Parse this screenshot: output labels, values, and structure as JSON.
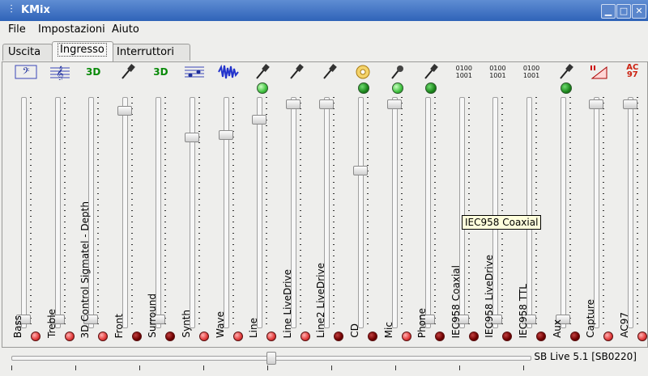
{
  "window": {
    "title": "KMix",
    "minimize": "▁",
    "maximize": "□",
    "close": "✕"
  },
  "menu": [
    "File",
    "Impostazioni",
    "Aiuto"
  ],
  "tabs": [
    {
      "label": "Uscita"
    },
    {
      "label": "Ingresso",
      "active": true
    },
    {
      "label": "Interruttori"
    }
  ],
  "channels": [
    {
      "label": "Bass",
      "icon": "bass-clef-icon",
      "level": 0.02,
      "led": null,
      "mute": "red"
    },
    {
      "label": "Treble",
      "icon": "treble-clef-icon",
      "level": 0.02,
      "led": null,
      "mute": "red"
    },
    {
      "label": "3D Control Sigmatel - Depth",
      "icon": "3d-icon",
      "icon_text": "3D",
      "level": 0.02,
      "led": null,
      "mute": "red"
    },
    {
      "label": "Front",
      "icon": "microphone-jack-icon",
      "level": 0.96,
      "led": null,
      "mute": "dark"
    },
    {
      "label": "Surround",
      "icon": "3d-icon",
      "icon_text": "3D",
      "level": 0.02,
      "led": null,
      "mute": "dark"
    },
    {
      "label": "Synth",
      "icon": "midi-icon",
      "level": 0.84,
      "led": null,
      "mute": "red"
    },
    {
      "label": "Wave",
      "icon": "waveform-icon",
      "level": 0.85,
      "led": null,
      "mute": "red"
    },
    {
      "label": "Line",
      "icon": "line-jack-icon",
      "level": 0.92,
      "led": "on",
      "mute": "red"
    },
    {
      "label": "Line LiveDrive",
      "icon": "line-jack-icon",
      "level": 0.99,
      "led": null,
      "mute": "red"
    },
    {
      "label": "Line2 LiveDrive",
      "icon": "line-jack-icon",
      "level": 0.99,
      "led": null,
      "mute": "dark"
    },
    {
      "label": "CD",
      "icon": "cd-icon",
      "level": 0.69,
      "led": "off",
      "mute": "dark"
    },
    {
      "label": "Mic",
      "icon": "microphone-icon",
      "level": 0.99,
      "led": "on",
      "mute": "red"
    },
    {
      "label": "Phone",
      "icon": "line-jack-icon",
      "level": 0.02,
      "led": "off",
      "mute": "dark"
    },
    {
      "label": "IEC958 Coaxial",
      "icon": "digital-icon",
      "icon_text": "0100\n1001",
      "level": 0.02,
      "led": null,
      "mute": "dark"
    },
    {
      "label": "IEC958 LiveDrive",
      "icon": "digital-icon",
      "icon_text": "0100\n1001",
      "level": 0.02,
      "led": null,
      "mute": "dark"
    },
    {
      "label": "IEC958 TTL",
      "icon": "digital-icon",
      "icon_text": "0100\n1001",
      "level": 0.02,
      "led": null,
      "mute": "dark"
    },
    {
      "label": "Aux",
      "icon": "line-jack-icon",
      "level": 0.02,
      "led": "off",
      "mute": "dark"
    },
    {
      "label": "Capture",
      "icon": "capture-icon",
      "level": 0.99,
      "led": null,
      "mute": "red"
    },
    {
      "label": "AC97",
      "icon": "ac97-icon",
      "icon_text": "AC\n97",
      "level": 0.99,
      "led": null,
      "mute": "red"
    }
  ],
  "tooltip": "IEC958 Coaxial",
  "master": {
    "card_name": "SB Live 5.1 [SB0220]",
    "level": 0.5
  }
}
